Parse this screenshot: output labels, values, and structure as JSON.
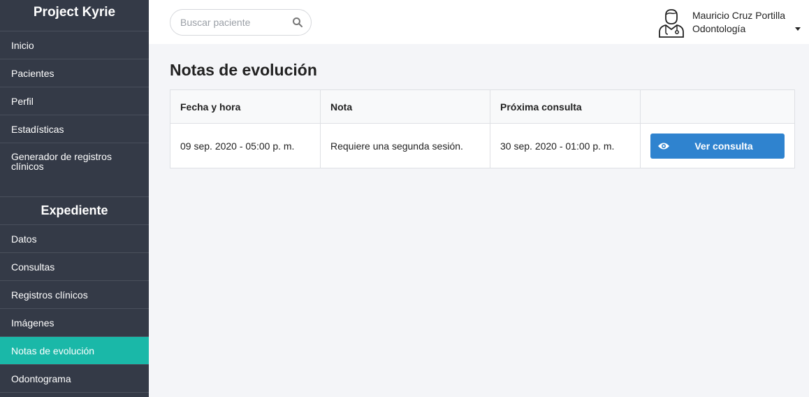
{
  "sidebar": {
    "brand": "Project Kyrie",
    "main_items": [
      {
        "label": "Inicio"
      },
      {
        "label": "Pacientes"
      },
      {
        "label": "Perfil"
      },
      {
        "label": "Estadísticas"
      },
      {
        "label": "Generador de registros clínicos"
      }
    ],
    "section_title": "Expediente",
    "record_items": [
      {
        "label": "Datos"
      },
      {
        "label": "Consultas"
      },
      {
        "label": "Registros clínicos"
      },
      {
        "label": "Imágenes"
      },
      {
        "label": "Notas de evolución",
        "active": true
      },
      {
        "label": "Odontograma"
      }
    ]
  },
  "header": {
    "search_placeholder": "Buscar paciente",
    "user": {
      "name": "Mauricio Cruz Portilla",
      "specialty": "Odontología"
    }
  },
  "main": {
    "title": "Notas de evolución",
    "table": {
      "columns": [
        "Fecha y hora",
        "Nota",
        "Próxima consulta",
        ""
      ],
      "rows": [
        {
          "date": "09 sep. 2020 - 05:00 p. m.",
          "note": "Requiere una segunda sesión.",
          "next": "30 sep. 2020 - 01:00 p. m.",
          "action": "Ver consulta"
        }
      ]
    }
  },
  "colors": {
    "sidebar_bg": "#343a47",
    "active_item": "#1ab8a8",
    "primary_button": "#2f83cf"
  }
}
